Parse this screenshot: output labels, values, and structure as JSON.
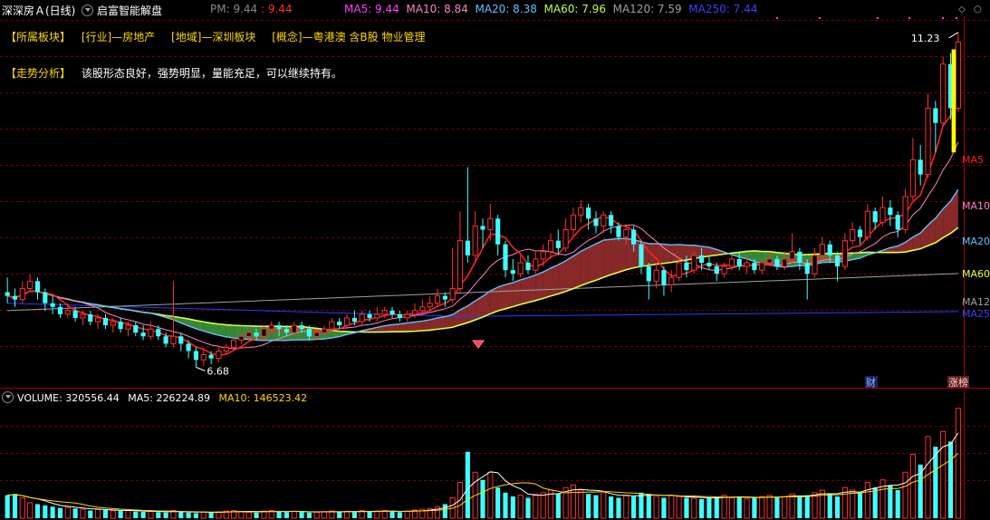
{
  "header": {
    "stock_name": "深深房Ａ(日线)",
    "indicator_name": "启富智能解盘",
    "pm_label": "PM: 9.44",
    "price_label": ": 9.44",
    "ma_readouts": [
      {
        "text": "MA5: 9.44",
        "color": "#ff40ff"
      },
      {
        "text": "MA10: 8.84",
        "color": "#ff80c0"
      },
      {
        "text": "MA20: 8.38",
        "color": "#60c0ff"
      },
      {
        "text": "MA60: 7.96",
        "color": "#c0ff40"
      },
      {
        "text": "MA120: 7.59",
        "color": "#a0a0a0"
      },
      {
        "text": "MA250: 7.44",
        "color": "#4040ff"
      }
    ]
  },
  "sector": {
    "label": "【所属板块】",
    "industry": "[行业]—房地产",
    "region": "[地域]—深圳板块",
    "concept": "[概念]—粤港澳 含B股 物业管理"
  },
  "analysis": {
    "label": "【走势分析】",
    "text": "该股形态良好，强势明显，量能充足，可以继续持有。"
  },
  "annotations": {
    "high_price": "11.23",
    "low_price": "6.68",
    "cai_tag": "财",
    "zhangting_tag": "涨榜"
  },
  "ma_tags": [
    {
      "text": "MA5",
      "color": "#ff2020"
    },
    {
      "text": "MA10",
      "color": "#ff80c0"
    },
    {
      "text": "MA20",
      "color": "#60c0ff"
    },
    {
      "text": "MA60",
      "color": "#e0ff40"
    },
    {
      "text": "MA12",
      "color": "#a0a0a0"
    },
    {
      "text": "MA25",
      "color": "#4040ff"
    }
  ],
  "volume_header": {
    "volume": "VOLUME: 320556.44",
    "ma5": "MA5: 226224.89",
    "ma10": "MA10: 146523.42"
  },
  "colors": {
    "up": "#ff3030",
    "down": "#40ffff",
    "ma5": "#ff2020",
    "ma10": "#ff80c0",
    "ma20": "#60c0ff",
    "ma60": "#e0ff40",
    "ma120": "#a0a0a0",
    "ma250": "#2040ff",
    "fill_up": "#a03030",
    "fill_down": "#40a040",
    "grid": "#7a0000"
  },
  "chart_data": [
    {
      "type": "candlestick",
      "title": "深深房Ａ(日线)",
      "price_range": [
        6.5,
        11.4
      ],
      "high_marker": 11.23,
      "low_marker": 6.68,
      "candles": [
        [
          7.7,
          7.65,
          7.9,
          7.55
        ],
        [
          7.65,
          7.6,
          7.75,
          7.5
        ],
        [
          7.6,
          7.75,
          7.85,
          7.55
        ],
        [
          7.75,
          7.85,
          7.95,
          7.7
        ],
        [
          7.85,
          7.7,
          7.9,
          7.6
        ],
        [
          7.7,
          7.55,
          7.75,
          7.45
        ],
        [
          7.55,
          7.5,
          7.65,
          7.4
        ],
        [
          7.5,
          7.4,
          7.55,
          7.35
        ],
        [
          7.4,
          7.45,
          7.55,
          7.35
        ],
        [
          7.45,
          7.35,
          7.5,
          7.3
        ],
        [
          7.35,
          7.4,
          7.45,
          7.25
        ],
        [
          7.4,
          7.3,
          7.45,
          7.25
        ],
        [
          7.3,
          7.35,
          7.4,
          7.2
        ],
        [
          7.35,
          7.25,
          7.4,
          7.2
        ],
        [
          7.25,
          7.3,
          7.35,
          7.15
        ],
        [
          7.3,
          7.2,
          7.35,
          7.15
        ],
        [
          7.2,
          7.25,
          7.3,
          7.1
        ],
        [
          7.25,
          7.15,
          7.3,
          7.1
        ],
        [
          7.15,
          7.1,
          7.25,
          7.05
        ],
        [
          7.1,
          7.2,
          7.3,
          7.05
        ],
        [
          7.2,
          7.1,
          7.25,
          7.05
        ],
        [
          7.1,
          7.0,
          7.15,
          6.95
        ],
        [
          7.0,
          7.1,
          7.85,
          6.95
        ],
        [
          7.1,
          7.0,
          7.15,
          6.9
        ],
        [
          7.0,
          6.9,
          7.05,
          6.8
        ],
        [
          6.9,
          6.78,
          6.95,
          6.68
        ],
        [
          6.78,
          6.85,
          6.92,
          6.7
        ],
        [
          6.85,
          6.8,
          6.9,
          6.72
        ],
        [
          6.8,
          6.9,
          6.95,
          6.75
        ],
        [
          6.9,
          6.95,
          7.0,
          6.85
        ],
        [
          6.95,
          7.05,
          7.1,
          6.9
        ],
        [
          7.05,
          7.1,
          7.15,
          7.0
        ],
        [
          7.1,
          7.15,
          7.2,
          7.05
        ],
        [
          7.15,
          7.1,
          7.2,
          7.05
        ],
        [
          7.1,
          7.2,
          7.25,
          7.05
        ],
        [
          7.2,
          7.25,
          7.3,
          7.15
        ],
        [
          7.25,
          7.2,
          7.3,
          7.1
        ],
        [
          7.2,
          7.15,
          7.25,
          7.1
        ],
        [
          7.15,
          7.25,
          7.3,
          7.1
        ],
        [
          7.25,
          7.2,
          7.3,
          7.15
        ],
        [
          7.2,
          7.1,
          7.25,
          7.05
        ],
        [
          7.1,
          7.15,
          7.2,
          7.05
        ],
        [
          7.15,
          7.2,
          7.25,
          7.1
        ],
        [
          7.2,
          7.3,
          7.35,
          7.15
        ],
        [
          7.3,
          7.25,
          7.35,
          7.2
        ],
        [
          7.25,
          7.35,
          7.4,
          7.2
        ],
        [
          7.35,
          7.3,
          7.45,
          7.25
        ],
        [
          7.3,
          7.4,
          7.45,
          7.25
        ],
        [
          7.4,
          7.35,
          7.45,
          7.3
        ],
        [
          7.35,
          7.4,
          7.5,
          7.3
        ],
        [
          7.4,
          7.45,
          7.5,
          7.35
        ],
        [
          7.45,
          7.4,
          7.5,
          7.35
        ],
        [
          7.4,
          7.35,
          7.45,
          7.3
        ],
        [
          7.35,
          7.4,
          7.45,
          7.3
        ],
        [
          7.4,
          7.45,
          7.55,
          7.35
        ],
        [
          7.45,
          7.5,
          7.6,
          7.4
        ],
        [
          7.5,
          7.55,
          7.65,
          7.45
        ],
        [
          7.55,
          7.65,
          7.75,
          7.5
        ],
        [
          7.65,
          7.6,
          7.7,
          7.5
        ],
        [
          7.6,
          7.75,
          8.3,
          7.55
        ],
        [
          7.75,
          8.4,
          8.8,
          7.7
        ],
        [
          8.4,
          8.2,
          9.4,
          8.1
        ],
        [
          8.2,
          8.6,
          8.8,
          8.1
        ],
        [
          8.6,
          8.55,
          8.7,
          8.3
        ],
        [
          8.55,
          8.7,
          8.9,
          8.4
        ],
        [
          8.7,
          8.35,
          8.75,
          8.2
        ],
        [
          8.35,
          8.0,
          8.4,
          7.9
        ],
        [
          8.0,
          7.95,
          8.15,
          7.85
        ],
        [
          7.95,
          8.1,
          8.2,
          7.9
        ],
        [
          8.1,
          8.0,
          8.2,
          7.95
        ],
        [
          8.0,
          8.15,
          8.25,
          7.95
        ],
        [
          8.15,
          8.25,
          8.35,
          8.05
        ],
        [
          8.25,
          8.4,
          8.5,
          8.15
        ],
        [
          8.4,
          8.3,
          8.55,
          8.2
        ],
        [
          8.3,
          8.55,
          8.7,
          8.25
        ],
        [
          8.55,
          8.75,
          8.85,
          8.45
        ],
        [
          8.75,
          8.85,
          8.95,
          8.65
        ],
        [
          8.85,
          8.7,
          8.9,
          8.55
        ],
        [
          8.7,
          8.6,
          8.8,
          8.5
        ],
        [
          8.6,
          8.75,
          8.8,
          8.5
        ],
        [
          8.75,
          8.6,
          8.8,
          8.5
        ],
        [
          8.6,
          8.45,
          8.65,
          8.4
        ],
        [
          8.45,
          8.55,
          8.6,
          8.35
        ],
        [
          8.55,
          8.35,
          8.6,
          8.25
        ],
        [
          8.35,
          8.05,
          8.4,
          7.95
        ],
        [
          8.05,
          7.85,
          8.1,
          7.6
        ],
        [
          7.85,
          8.0,
          8.1,
          7.75
        ],
        [
          8.0,
          7.8,
          8.05,
          7.65
        ],
        [
          7.8,
          7.9,
          8.0,
          7.7
        ],
        [
          7.9,
          8.1,
          8.15,
          7.85
        ],
        [
          8.1,
          8.0,
          8.2,
          7.9
        ],
        [
          8.0,
          8.2,
          8.25,
          7.95
        ],
        [
          8.2,
          8.1,
          8.3,
          8.0
        ],
        [
          8.1,
          8.05,
          8.2,
          8.0
        ],
        [
          8.05,
          7.95,
          8.1,
          7.85
        ],
        [
          7.95,
          8.05,
          8.1,
          7.9
        ],
        [
          8.05,
          8.15,
          8.2,
          8.0
        ],
        [
          8.15,
          8.05,
          8.25,
          8.0
        ],
        [
          8.05,
          8.1,
          8.2,
          7.95
        ],
        [
          8.1,
          8.0,
          8.15,
          7.95
        ],
        [
          8.0,
          8.1,
          8.15,
          7.95
        ],
        [
          8.1,
          8.15,
          8.25,
          8.05
        ],
        [
          8.15,
          8.05,
          8.2,
          8.0
        ],
        [
          8.05,
          8.15,
          8.25,
          8.0
        ],
        [
          8.15,
          8.25,
          8.5,
          8.1
        ],
        [
          8.25,
          8.1,
          8.3,
          8.0
        ],
        [
          8.1,
          7.95,
          8.15,
          7.6
        ],
        [
          7.95,
          8.2,
          8.3,
          7.9
        ],
        [
          8.2,
          8.35,
          8.45,
          8.15
        ],
        [
          8.35,
          8.2,
          8.4,
          8.1
        ],
        [
          8.2,
          8.05,
          8.25,
          7.85
        ],
        [
          8.05,
          8.4,
          8.5,
          8.0
        ],
        [
          8.4,
          8.55,
          8.65,
          8.35
        ],
        [
          8.55,
          8.45,
          8.6,
          8.35
        ],
        [
          8.45,
          8.8,
          8.9,
          8.4
        ],
        [
          8.8,
          8.65,
          8.85,
          8.55
        ],
        [
          8.65,
          8.85,
          9.0,
          8.6
        ],
        [
          8.85,
          8.75,
          8.95,
          8.6
        ],
        [
          8.75,
          8.55,
          8.8,
          8.45
        ],
        [
          8.55,
          9.0,
          9.1,
          8.5
        ],
        [
          9.0,
          9.5,
          9.8,
          8.95
        ],
        [
          9.5,
          9.3,
          9.7,
          9.15
        ],
        [
          9.3,
          10.2,
          10.4,
          9.25
        ],
        [
          10.2,
          10.0,
          10.3,
          9.6
        ],
        [
          10.0,
          10.8,
          10.9,
          9.95
        ],
        [
          10.8,
          10.2,
          10.95,
          10.05
        ],
        [
          10.2,
          11.1,
          11.23,
          10.15
        ]
      ]
    },
    {
      "type": "bar",
      "title": "VOLUME",
      "values": [
        90,
        95,
        80,
        60,
        55,
        50,
        45,
        40,
        42,
        38,
        35,
        30,
        34,
        32,
        30,
        28,
        30,
        26,
        25,
        27,
        24,
        22,
        30,
        25,
        22,
        20,
        24,
        22,
        25,
        28,
        30,
        26,
        24,
        22,
        28,
        30,
        26,
        24,
        27,
        25,
        22,
        24,
        26,
        28,
        25,
        27,
        24,
        30,
        26,
        28,
        30,
        26,
        24,
        28,
        32,
        35,
        38,
        45,
        55,
        80,
        140,
        260,
        180,
        150,
        180,
        120,
        100,
        85,
        90,
        80,
        95,
        100,
        110,
        95,
        120,
        130,
        110,
        95,
        90,
        100,
        85,
        80,
        90,
        85,
        100,
        95,
        85,
        80,
        90,
        85,
        80,
        78,
        75,
        80,
        85,
        90,
        80,
        85,
        75,
        80,
        85,
        90,
        80,
        85,
        95,
        85,
        90,
        100,
        110,
        95,
        85,
        120,
        110,
        100,
        140,
        120,
        150,
        130,
        110,
        180,
        250,
        210,
        320,
        280,
        340,
        300,
        430
      ],
      "ymax": 440
    }
  ]
}
